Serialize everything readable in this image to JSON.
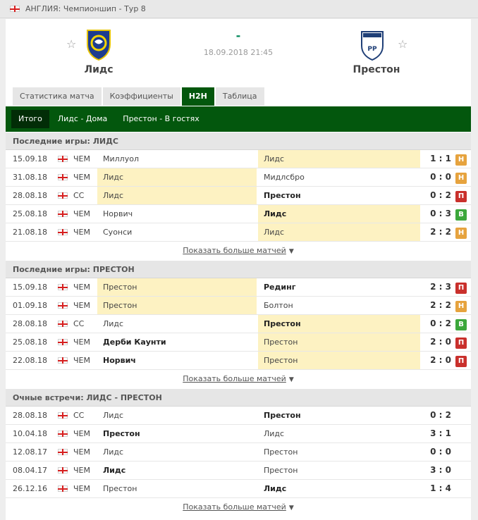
{
  "breadcrumb": "АНГЛИЯ: Чемпионшип - Тур 8",
  "match": {
    "home_team": "Лидс",
    "away_team": "Престон",
    "score": "-",
    "datetime": "18.09.2018 21:45",
    "away_logo_text": "PP"
  },
  "tabs": [
    "Статистика матча",
    "Коэффициенты",
    "H2H",
    "Таблица"
  ],
  "active_tab": "H2H",
  "subtabs": [
    "Итого",
    "Лидс - Дома",
    "Престон - В гостях"
  ],
  "active_subtab": "Итого",
  "more_label": "Показать больше матчей",
  "sections": [
    {
      "title": "Последние игры: ЛИДС",
      "rows": [
        {
          "date": "15.09.18",
          "comp": "ЧЕМ",
          "home": "Миллуол",
          "away": "Лидс",
          "score": "1 : 1",
          "badge": "Н",
          "result": "draw",
          "hl": "away",
          "bold": ""
        },
        {
          "date": "31.08.18",
          "comp": "ЧЕМ",
          "home": "Лидс",
          "away": "Мидлсбро",
          "score": "0 : 0",
          "badge": "Н",
          "result": "draw",
          "hl": "home",
          "bold": ""
        },
        {
          "date": "28.08.18",
          "comp": "СС",
          "home": "Лидс",
          "away": "Престон",
          "score": "0 : 2",
          "badge": "П",
          "result": "loss",
          "hl": "home",
          "bold": "away"
        },
        {
          "date": "25.08.18",
          "comp": "ЧЕМ",
          "home": "Норвич",
          "away": "Лидс",
          "score": "0 : 3",
          "badge": "В",
          "result": "win",
          "hl": "away",
          "bold": "away"
        },
        {
          "date": "21.08.18",
          "comp": "ЧЕМ",
          "home": "Суонси",
          "away": "Лидс",
          "score": "2 : 2",
          "badge": "Н",
          "result": "draw",
          "hl": "away",
          "bold": ""
        }
      ]
    },
    {
      "title": "Последние игры: ПРЕСТОН",
      "rows": [
        {
          "date": "15.09.18",
          "comp": "ЧЕМ",
          "home": "Престон",
          "away": "Рединг",
          "score": "2 : 3",
          "badge": "П",
          "result": "loss",
          "hl": "home",
          "bold": "away"
        },
        {
          "date": "01.09.18",
          "comp": "ЧЕМ",
          "home": "Престон",
          "away": "Болтон",
          "score": "2 : 2",
          "badge": "Н",
          "result": "draw",
          "hl": "home",
          "bold": ""
        },
        {
          "date": "28.08.18",
          "comp": "СС",
          "home": "Лидс",
          "away": "Престон",
          "score": "0 : 2",
          "badge": "В",
          "result": "win",
          "hl": "away",
          "bold": "away"
        },
        {
          "date": "25.08.18",
          "comp": "ЧЕМ",
          "home": "Дерби Каунти",
          "away": "Престон",
          "score": "2 : 0",
          "badge": "П",
          "result": "loss",
          "hl": "away",
          "bold": "home"
        },
        {
          "date": "22.08.18",
          "comp": "ЧЕМ",
          "home": "Норвич",
          "away": "Престон",
          "score": "2 : 0",
          "badge": "П",
          "result": "loss",
          "hl": "away",
          "bold": "home"
        }
      ]
    },
    {
      "title": "Очные встречи: ЛИДС - ПРЕСТОН",
      "rows": [
        {
          "date": "28.08.18",
          "comp": "СС",
          "home": "Лидс",
          "away": "Престон",
          "score": "0 : 2",
          "badge": "",
          "result": "",
          "hl": "",
          "bold": "away"
        },
        {
          "date": "10.04.18",
          "comp": "ЧЕМ",
          "home": "Престон",
          "away": "Лидс",
          "score": "3 : 1",
          "badge": "",
          "result": "",
          "hl": "",
          "bold": "home"
        },
        {
          "date": "12.08.17",
          "comp": "ЧЕМ",
          "home": "Лидс",
          "away": "Престон",
          "score": "0 : 0",
          "badge": "",
          "result": "",
          "hl": "",
          "bold": ""
        },
        {
          "date": "08.04.17",
          "comp": "ЧЕМ",
          "home": "Лидс",
          "away": "Престон",
          "score": "3 : 0",
          "badge": "",
          "result": "",
          "hl": "",
          "bold": "home"
        },
        {
          "date": "26.12.16",
          "comp": "ЧЕМ",
          "home": "Престон",
          "away": "Лидс",
          "score": "1 : 4",
          "badge": "",
          "result": "",
          "hl": "",
          "bold": "away"
        }
      ]
    }
  ]
}
